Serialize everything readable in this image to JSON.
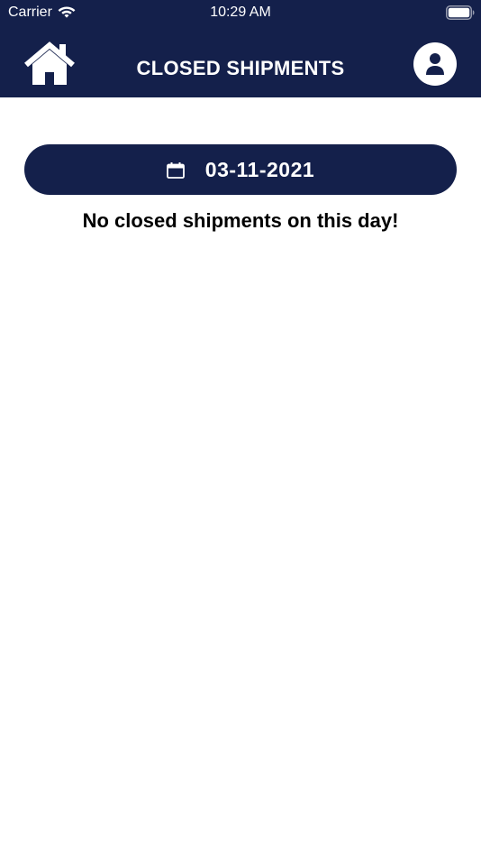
{
  "status_bar": {
    "carrier": "Carrier",
    "time": "10:29 AM"
  },
  "header": {
    "title": "CLOSED SHIPMENTS",
    "home_icon": "home-icon",
    "profile_icon": "user-icon"
  },
  "date_picker": {
    "icon": "calendar-icon",
    "value": "03-11-2021"
  },
  "main": {
    "empty_message": "No closed shipments on this day!"
  },
  "colors": {
    "primary": "#14204b",
    "background": "#ffffff",
    "text": "#000000"
  }
}
